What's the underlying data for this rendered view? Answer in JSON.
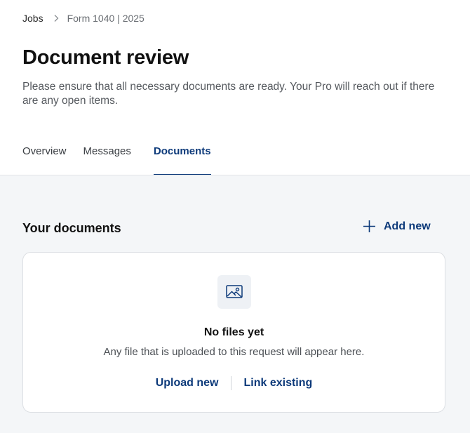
{
  "breadcrumb": {
    "root": "Jobs",
    "current": "Form 1040 | 2025"
  },
  "header": {
    "title": "Document review",
    "subtitle": "Please ensure that all necessary documents are ready. Your Pro will reach out if there are any open items."
  },
  "tabs": [
    {
      "label": "Overview",
      "active": false
    },
    {
      "label": "Messages",
      "active": false
    },
    {
      "label": "Documents",
      "active": true
    }
  ],
  "documents": {
    "section_title": "Your documents",
    "add_new_label": "Add new",
    "empty_state": {
      "icon": "image-icon",
      "title": "No files yet",
      "description": "Any file that is uploaded to this request will appear here.",
      "upload_label": "Upload new",
      "link_label": "Link existing"
    }
  },
  "colors": {
    "accent": "#0d3a7a",
    "background_lower": "#f4f6f8",
    "card_border": "#dcdfe3"
  }
}
